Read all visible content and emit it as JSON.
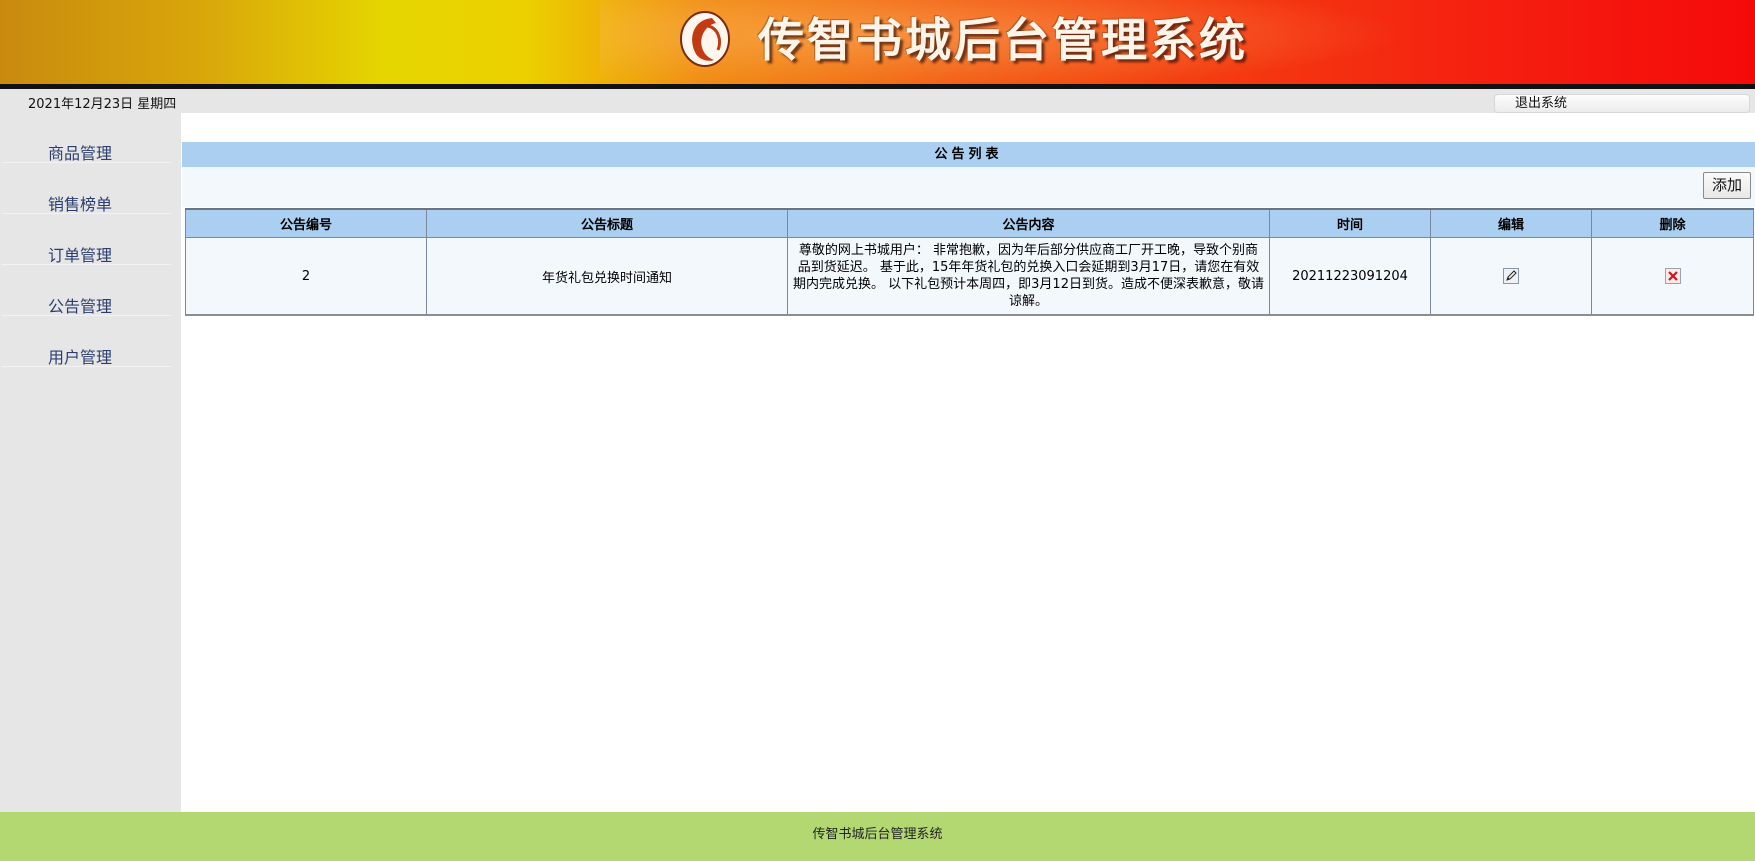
{
  "header": {
    "title": "传智书城后台管理系统"
  },
  "infobar": {
    "date": "2021年12月23日 星期四",
    "logout_label": "退出系统"
  },
  "sidebar": {
    "items": [
      {
        "label": "商品管理"
      },
      {
        "label": "销售榜单"
      },
      {
        "label": "订单管理"
      },
      {
        "label": "公告管理"
      },
      {
        "label": "用户管理"
      }
    ]
  },
  "main": {
    "list_title": "公告列表",
    "add_label": "添加",
    "columns": [
      "公告编号",
      "公告标题",
      "公告内容",
      "时间",
      "编辑",
      "删除"
    ],
    "rows": [
      {
        "id": "2",
        "title": "年货礼包兑换时间通知",
        "content": "尊敬的网上书城用户： 非常抱歉，因为年后部分供应商工厂开工晚，导致个别商品到货延迟。 基于此，15年年货礼包的兑换入口会延期到3月17日，请您在有效期内完成兑换。 以下礼包预计本周四，即3月12日到货。造成不便深表歉意，敬请谅解。",
        "time": "20211223091204",
        "edit_icon": "edit-pencil-icon",
        "delete_icon": "delete-x-icon"
      }
    ]
  },
  "footer": {
    "text": "传智书城后台管理系统"
  },
  "colors": {
    "header_bar": "#aacff1",
    "row_bg": "#f3f8fd",
    "sidebar_bg": "#e6e6e6",
    "footer_bg": "#b3d872",
    "sidebar_text": "#2b3e6e"
  }
}
